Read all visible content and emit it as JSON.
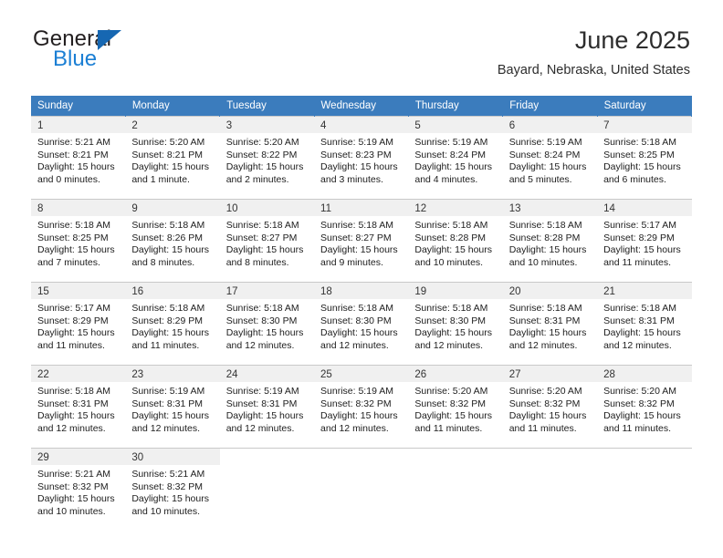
{
  "brand": {
    "name_part1": "General",
    "name_part2": "Blue",
    "logo_icon": "triangle-flag-icon",
    "colors": {
      "dark": "#231f20",
      "blue": "#1b7fd4",
      "triangle": "#1667b2"
    }
  },
  "header": {
    "title": "June 2025",
    "subtitle": "Bayard, Nebraska, United States"
  },
  "calendar": {
    "accent_color": "#3b7cbd",
    "daynum_background": "#f0f0f0",
    "weekday_headers": [
      "Sunday",
      "Monday",
      "Tuesday",
      "Wednesday",
      "Thursday",
      "Friday",
      "Saturday"
    ],
    "weeks": [
      [
        {
          "day": "1",
          "sunrise": "Sunrise: 5:21 AM",
          "sunset": "Sunset: 8:21 PM",
          "daylight_line1": "Daylight: 15 hours",
          "daylight_line2": "and 0 minutes."
        },
        {
          "day": "2",
          "sunrise": "Sunrise: 5:20 AM",
          "sunset": "Sunset: 8:21 PM",
          "daylight_line1": "Daylight: 15 hours",
          "daylight_line2": "and 1 minute."
        },
        {
          "day": "3",
          "sunrise": "Sunrise: 5:20 AM",
          "sunset": "Sunset: 8:22 PM",
          "daylight_line1": "Daylight: 15 hours",
          "daylight_line2": "and 2 minutes."
        },
        {
          "day": "4",
          "sunrise": "Sunrise: 5:19 AM",
          "sunset": "Sunset: 8:23 PM",
          "daylight_line1": "Daylight: 15 hours",
          "daylight_line2": "and 3 minutes."
        },
        {
          "day": "5",
          "sunrise": "Sunrise: 5:19 AM",
          "sunset": "Sunset: 8:24 PM",
          "daylight_line1": "Daylight: 15 hours",
          "daylight_line2": "and 4 minutes."
        },
        {
          "day": "6",
          "sunrise": "Sunrise: 5:19 AM",
          "sunset": "Sunset: 8:24 PM",
          "daylight_line1": "Daylight: 15 hours",
          "daylight_line2": "and 5 minutes."
        },
        {
          "day": "7",
          "sunrise": "Sunrise: 5:18 AM",
          "sunset": "Sunset: 8:25 PM",
          "daylight_line1": "Daylight: 15 hours",
          "daylight_line2": "and 6 minutes."
        }
      ],
      [
        {
          "day": "8",
          "sunrise": "Sunrise: 5:18 AM",
          "sunset": "Sunset: 8:25 PM",
          "daylight_line1": "Daylight: 15 hours",
          "daylight_line2": "and 7 minutes."
        },
        {
          "day": "9",
          "sunrise": "Sunrise: 5:18 AM",
          "sunset": "Sunset: 8:26 PM",
          "daylight_line1": "Daylight: 15 hours",
          "daylight_line2": "and 8 minutes."
        },
        {
          "day": "10",
          "sunrise": "Sunrise: 5:18 AM",
          "sunset": "Sunset: 8:27 PM",
          "daylight_line1": "Daylight: 15 hours",
          "daylight_line2": "and 8 minutes."
        },
        {
          "day": "11",
          "sunrise": "Sunrise: 5:18 AM",
          "sunset": "Sunset: 8:27 PM",
          "daylight_line1": "Daylight: 15 hours",
          "daylight_line2": "and 9 minutes."
        },
        {
          "day": "12",
          "sunrise": "Sunrise: 5:18 AM",
          "sunset": "Sunset: 8:28 PM",
          "daylight_line1": "Daylight: 15 hours",
          "daylight_line2": "and 10 minutes."
        },
        {
          "day": "13",
          "sunrise": "Sunrise: 5:18 AM",
          "sunset": "Sunset: 8:28 PM",
          "daylight_line1": "Daylight: 15 hours",
          "daylight_line2": "and 10 minutes."
        },
        {
          "day": "14",
          "sunrise": "Sunrise: 5:17 AM",
          "sunset": "Sunset: 8:29 PM",
          "daylight_line1": "Daylight: 15 hours",
          "daylight_line2": "and 11 minutes."
        }
      ],
      [
        {
          "day": "15",
          "sunrise": "Sunrise: 5:17 AM",
          "sunset": "Sunset: 8:29 PM",
          "daylight_line1": "Daylight: 15 hours",
          "daylight_line2": "and 11 minutes."
        },
        {
          "day": "16",
          "sunrise": "Sunrise: 5:18 AM",
          "sunset": "Sunset: 8:29 PM",
          "daylight_line1": "Daylight: 15 hours",
          "daylight_line2": "and 11 minutes."
        },
        {
          "day": "17",
          "sunrise": "Sunrise: 5:18 AM",
          "sunset": "Sunset: 8:30 PM",
          "daylight_line1": "Daylight: 15 hours",
          "daylight_line2": "and 12 minutes."
        },
        {
          "day": "18",
          "sunrise": "Sunrise: 5:18 AM",
          "sunset": "Sunset: 8:30 PM",
          "daylight_line1": "Daylight: 15 hours",
          "daylight_line2": "and 12 minutes."
        },
        {
          "day": "19",
          "sunrise": "Sunrise: 5:18 AM",
          "sunset": "Sunset: 8:30 PM",
          "daylight_line1": "Daylight: 15 hours",
          "daylight_line2": "and 12 minutes."
        },
        {
          "day": "20",
          "sunrise": "Sunrise: 5:18 AM",
          "sunset": "Sunset: 8:31 PM",
          "daylight_line1": "Daylight: 15 hours",
          "daylight_line2": "and 12 minutes."
        },
        {
          "day": "21",
          "sunrise": "Sunrise: 5:18 AM",
          "sunset": "Sunset: 8:31 PM",
          "daylight_line1": "Daylight: 15 hours",
          "daylight_line2": "and 12 minutes."
        }
      ],
      [
        {
          "day": "22",
          "sunrise": "Sunrise: 5:18 AM",
          "sunset": "Sunset: 8:31 PM",
          "daylight_line1": "Daylight: 15 hours",
          "daylight_line2": "and 12 minutes."
        },
        {
          "day": "23",
          "sunrise": "Sunrise: 5:19 AM",
          "sunset": "Sunset: 8:31 PM",
          "daylight_line1": "Daylight: 15 hours",
          "daylight_line2": "and 12 minutes."
        },
        {
          "day": "24",
          "sunrise": "Sunrise: 5:19 AM",
          "sunset": "Sunset: 8:31 PM",
          "daylight_line1": "Daylight: 15 hours",
          "daylight_line2": "and 12 minutes."
        },
        {
          "day": "25",
          "sunrise": "Sunrise: 5:19 AM",
          "sunset": "Sunset: 8:32 PM",
          "daylight_line1": "Daylight: 15 hours",
          "daylight_line2": "and 12 minutes."
        },
        {
          "day": "26",
          "sunrise": "Sunrise: 5:20 AM",
          "sunset": "Sunset: 8:32 PM",
          "daylight_line1": "Daylight: 15 hours",
          "daylight_line2": "and 11 minutes."
        },
        {
          "day": "27",
          "sunrise": "Sunrise: 5:20 AM",
          "sunset": "Sunset: 8:32 PM",
          "daylight_line1": "Daylight: 15 hours",
          "daylight_line2": "and 11 minutes."
        },
        {
          "day": "28",
          "sunrise": "Sunrise: 5:20 AM",
          "sunset": "Sunset: 8:32 PM",
          "daylight_line1": "Daylight: 15 hours",
          "daylight_line2": "and 11 minutes."
        }
      ],
      [
        {
          "day": "29",
          "sunrise": "Sunrise: 5:21 AM",
          "sunset": "Sunset: 8:32 PM",
          "daylight_line1": "Daylight: 15 hours",
          "daylight_line2": "and 10 minutes."
        },
        {
          "day": "30",
          "sunrise": "Sunrise: 5:21 AM",
          "sunset": "Sunset: 8:32 PM",
          "daylight_line1": "Daylight: 15 hours",
          "daylight_line2": "and 10 minutes."
        },
        {
          "day": "",
          "sunrise": "",
          "sunset": "",
          "daylight_line1": "",
          "daylight_line2": ""
        },
        {
          "day": "",
          "sunrise": "",
          "sunset": "",
          "daylight_line1": "",
          "daylight_line2": ""
        },
        {
          "day": "",
          "sunrise": "",
          "sunset": "",
          "daylight_line1": "",
          "daylight_line2": ""
        },
        {
          "day": "",
          "sunrise": "",
          "sunset": "",
          "daylight_line1": "",
          "daylight_line2": ""
        },
        {
          "day": "",
          "sunrise": "",
          "sunset": "",
          "daylight_line1": "",
          "daylight_line2": ""
        }
      ]
    ]
  }
}
